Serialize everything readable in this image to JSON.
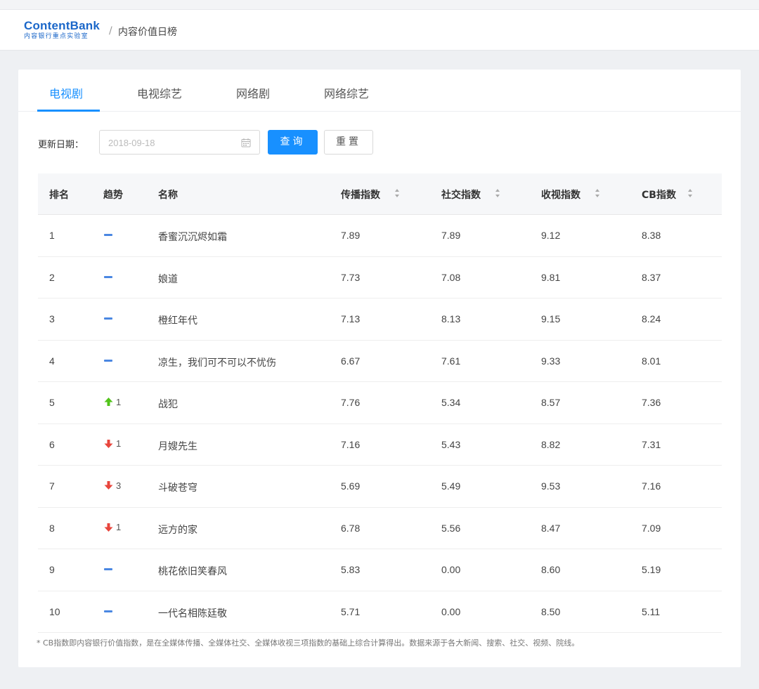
{
  "header": {
    "logo_main": "ContentBank",
    "logo_sub": "内容银行重点实验室",
    "separator": "/",
    "page_title": "内容价值日榜"
  },
  "tabs": [
    {
      "label": "电视剧",
      "active": true
    },
    {
      "label": "电视综艺",
      "active": false
    },
    {
      "label": "网络剧",
      "active": false
    },
    {
      "label": "网络综艺",
      "active": false
    }
  ],
  "filter": {
    "date_label": "更新日期：",
    "date_placeholder": "2018-09-18",
    "query_label": "查询",
    "reset_label": "重置"
  },
  "table": {
    "columns": [
      "排名",
      "趋势",
      "名称",
      "传播指数",
      "社交指数",
      "收视指数",
      "CB指数"
    ],
    "rows": [
      {
        "rank": "1",
        "trend": "flat",
        "change": "",
        "name": "香蜜沉沉烬如霜",
        "spread": "7.89",
        "social": "7.89",
        "rating": "9.12",
        "cb": "8.38"
      },
      {
        "rank": "2",
        "trend": "flat",
        "change": "",
        "name": "娘道",
        "spread": "7.73",
        "social": "7.08",
        "rating": "9.81",
        "cb": "8.37"
      },
      {
        "rank": "3",
        "trend": "flat",
        "change": "",
        "name": "橙红年代",
        "spread": "7.13",
        "social": "8.13",
        "rating": "9.15",
        "cb": "8.24"
      },
      {
        "rank": "4",
        "trend": "flat",
        "change": "",
        "name": "凉生，我们可不可以不忧伤",
        "spread": "6.67",
        "social": "7.61",
        "rating": "9.33",
        "cb": "8.01"
      },
      {
        "rank": "5",
        "trend": "up",
        "change": "1",
        "name": "战犯",
        "spread": "7.76",
        "social": "5.34",
        "rating": "8.57",
        "cb": "7.36"
      },
      {
        "rank": "6",
        "trend": "down",
        "change": "1",
        "name": "月嫂先生",
        "spread": "7.16",
        "social": "5.43",
        "rating": "8.82",
        "cb": "7.31"
      },
      {
        "rank": "7",
        "trend": "down",
        "change": "3",
        "name": "斗破苍穹",
        "spread": "5.69",
        "social": "5.49",
        "rating": "9.53",
        "cb": "7.16"
      },
      {
        "rank": "8",
        "trend": "down",
        "change": "1",
        "name": "远方的家",
        "spread": "6.78",
        "social": "5.56",
        "rating": "8.47",
        "cb": "7.09"
      },
      {
        "rank": "9",
        "trend": "flat",
        "change": "",
        "name": "桃花依旧笑春风",
        "spread": "5.83",
        "social": "0.00",
        "rating": "8.60",
        "cb": "5.19"
      },
      {
        "rank": "10",
        "trend": "flat",
        "change": "",
        "name": "一代名相陈廷敬",
        "spread": "5.71",
        "social": "0.00",
        "rating": "8.50",
        "cb": "5.11"
      }
    ]
  },
  "footnote": "* CB指数即内容银行价值指数，是在全媒体传播、全媒体社交、全媒体收视三项指数的基础上综合计算得出。数据来源于各大新闻、搜索、社交、视频、院线。",
  "colors": {
    "accent": "#1890ff",
    "brand": "#1b67c9",
    "trend_up": "#52c41a",
    "trend_down": "#e8453c",
    "trend_flat": "#4a87e2"
  }
}
